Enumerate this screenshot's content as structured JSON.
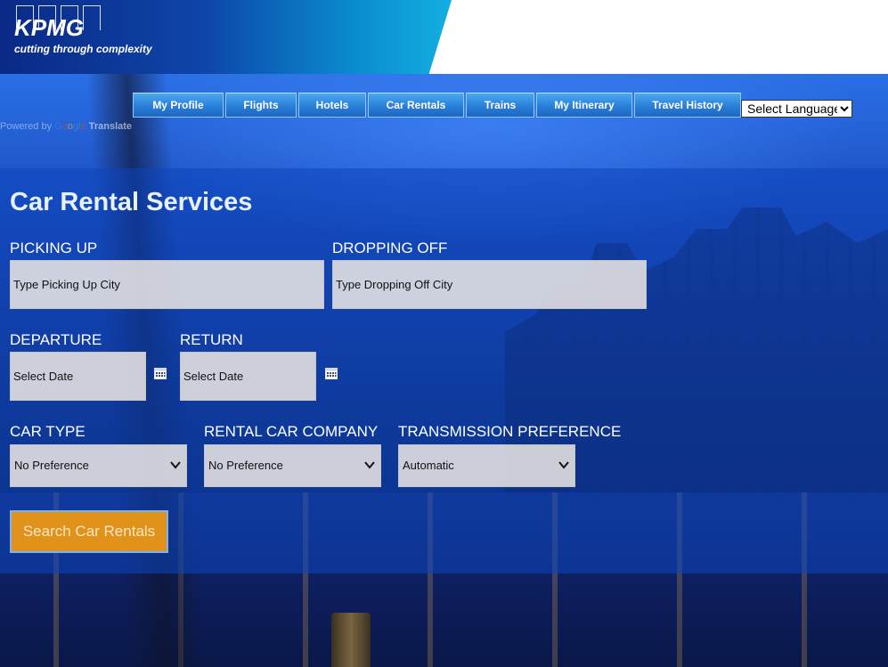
{
  "brand": {
    "name": "KPMG",
    "tagline": "cutting through complexity"
  },
  "nav": {
    "items": [
      {
        "label": "My Profile"
      },
      {
        "label": "Flights"
      },
      {
        "label": "Hotels"
      },
      {
        "label": "Car Rentals"
      },
      {
        "label": "Trains"
      },
      {
        "label": "My Itinerary"
      },
      {
        "label": "Travel History"
      }
    ],
    "language_select": "Select Language"
  },
  "translate": {
    "powered_by": "Powered by",
    "google": [
      "G",
      "o",
      "o",
      "g",
      "l",
      "e"
    ],
    "translate": "Translate"
  },
  "form": {
    "title": "Car Rental Services",
    "picking_up": {
      "label": "PICKING UP",
      "placeholder": "Type Picking Up City"
    },
    "dropping_off": {
      "label": "DROPPING OFF",
      "placeholder": "Type Dropping Off City"
    },
    "departure": {
      "label": "DEPARTURE",
      "placeholder": "Select Date"
    },
    "return": {
      "label": "RETURN",
      "placeholder": "Select Date"
    },
    "car_type": {
      "label": "CAR TYPE",
      "value": "No Preference"
    },
    "rental_company": {
      "label": "RENTAL CAR COMPANY",
      "value": "No Preference"
    },
    "transmission": {
      "label": "TRANSMISSION PREFERENCE",
      "value": "Automatic"
    },
    "search_button": "Search Car Rentals"
  },
  "colors": {
    "accent_button": "#e0921a",
    "nav_button": "#2a7fd8",
    "panel_overlay": "#0c46be"
  }
}
